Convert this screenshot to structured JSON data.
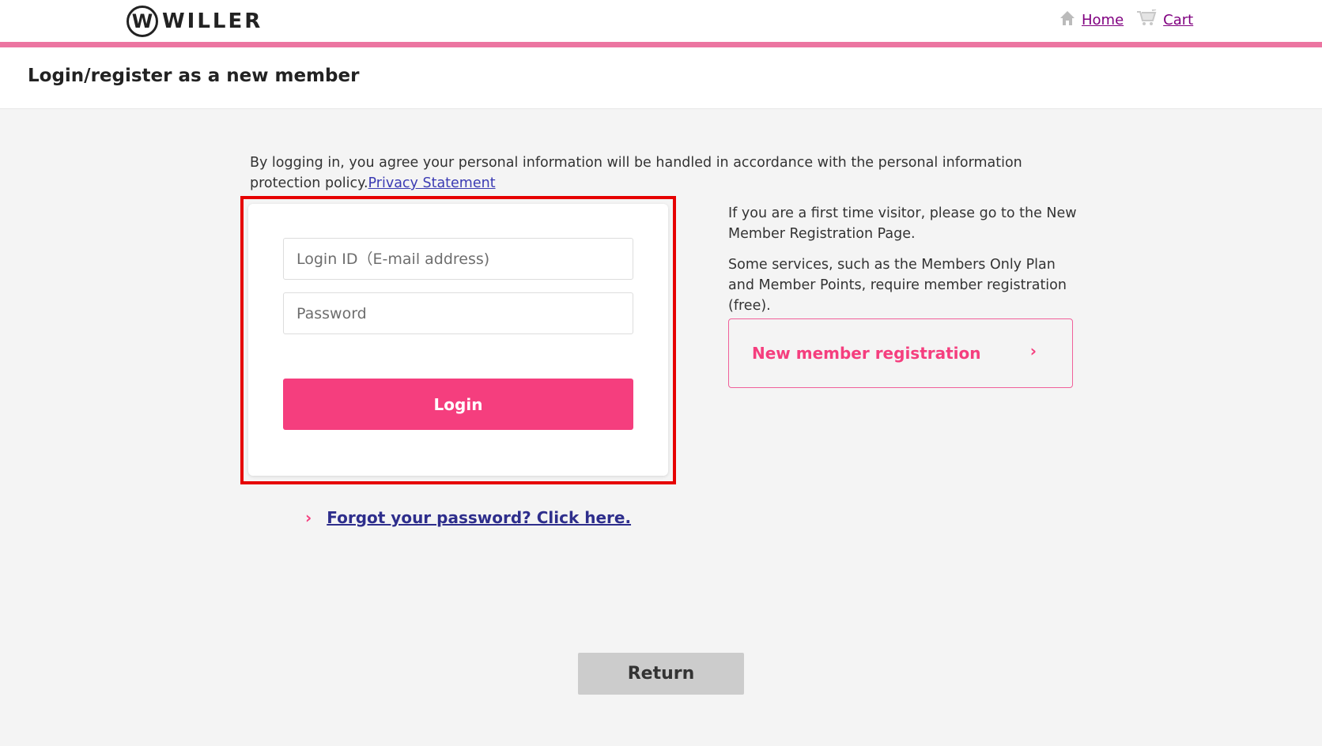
{
  "header": {
    "logo_mark": "W",
    "logo_text": "WILLER",
    "nav": {
      "home_icon": "home-icon",
      "home_label": "Home",
      "cart_icon": "cart-icon",
      "cart_label": "Cart"
    },
    "accent_color": "#ec75a1"
  },
  "page": {
    "title": "Login/register as a new member"
  },
  "intro": {
    "text": "By logging in, you agree your personal information will be handled in accordance with the personal information protection policy.",
    "privacy_link": "Privacy Statement"
  },
  "login_form": {
    "login_id_placeholder": "Login ID（E-mail address)",
    "login_id_value": "",
    "password_placeholder": "Password",
    "password_value": "",
    "login_button": "Login",
    "highlight_color": "#e60000",
    "button_color": "#f53e7e"
  },
  "forgot": {
    "chevron": "›",
    "label": "Forgot your password? Click here."
  },
  "registration": {
    "paragraph1": "If you are a first time visitor, please go to the New Member Registration Page.",
    "paragraph2": "Some services, such as the Members Only Plan and Member Points, require member registration (free).",
    "button_label": "New member registration",
    "chevron": "›"
  },
  "footer": {
    "return_button": "Return"
  }
}
